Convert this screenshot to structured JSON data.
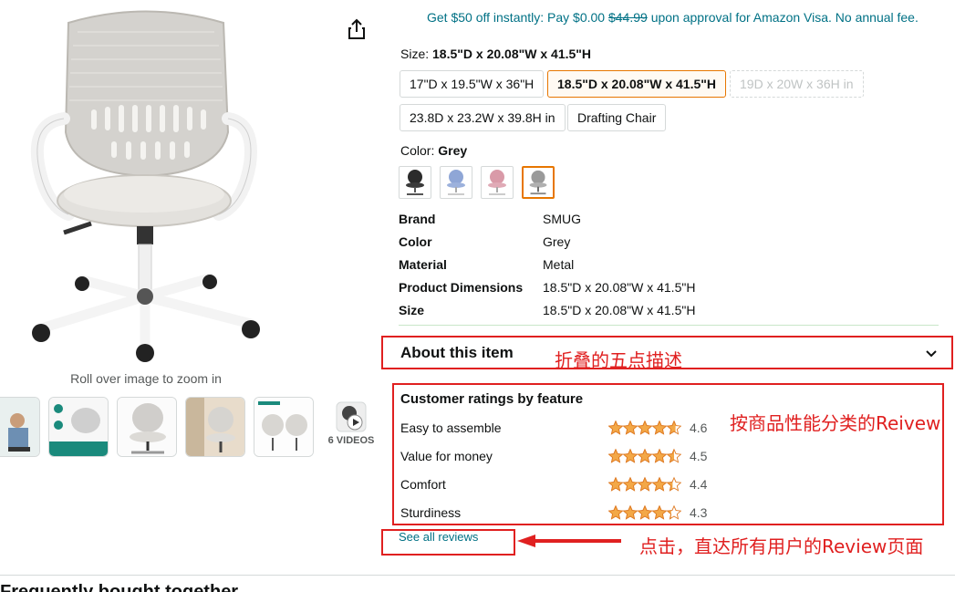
{
  "image": {
    "zoom_hint": "Roll over image to zoom in",
    "videos_label": "6 VIDEOS"
  },
  "promo": {
    "prefix": "Get $50 off instantly: Pay $0.00 ",
    "strike_price": "$44.99",
    "suffix": " upon approval for Amazon Visa. No annual fee."
  },
  "size": {
    "label": "Size: ",
    "selected_value": "18.5\"D x 20.08\"W x 41.5\"H",
    "options": [
      "17\"D x 19.5\"W x 36\"H",
      "18.5\"D x 20.08\"W x 41.5\"H",
      "19D x 20W x 36H in",
      "23.8D x 23.2W x 39.8H in",
      "Drafting Chair"
    ]
  },
  "color": {
    "label": "Color: ",
    "selected_value": "Grey",
    "swatch_colors": [
      "#2b2b2b",
      "#8fa6d6",
      "#d99aa8",
      "#9a9a9a"
    ]
  },
  "specs": [
    {
      "key": "Brand",
      "value": "SMUG"
    },
    {
      "key": "Color",
      "value": "Grey"
    },
    {
      "key": "Material",
      "value": "Metal"
    },
    {
      "key": "Product Dimensions",
      "value": "18.5\"D x 20.08\"W x 41.5\"H"
    },
    {
      "key": "Size",
      "value": "18.5\"D x 20.08\"W x 41.5\"H"
    }
  ],
  "about": {
    "title": "About this item",
    "annotation": "折叠的五点描述"
  },
  "ratings": {
    "title": "Customer ratings by feature",
    "annotation": "按商品性能分类的Reivew",
    "items": [
      {
        "label": "Easy to assemble",
        "value": "4.6"
      },
      {
        "label": "Value for money",
        "value": "4.5"
      },
      {
        "label": "Comfort",
        "value": "4.4"
      },
      {
        "label": "Sturdiness",
        "value": "4.3"
      }
    ]
  },
  "see_all": {
    "label": "See all reviews",
    "annotation": "点击，直达所有用户的Review页面"
  },
  "bottom": {
    "heading": "Frequently bought together"
  },
  "colors": {
    "link": "#007185",
    "selected_border": "#e77600",
    "star": "#f3a847",
    "annotation_red": "#e02020"
  }
}
